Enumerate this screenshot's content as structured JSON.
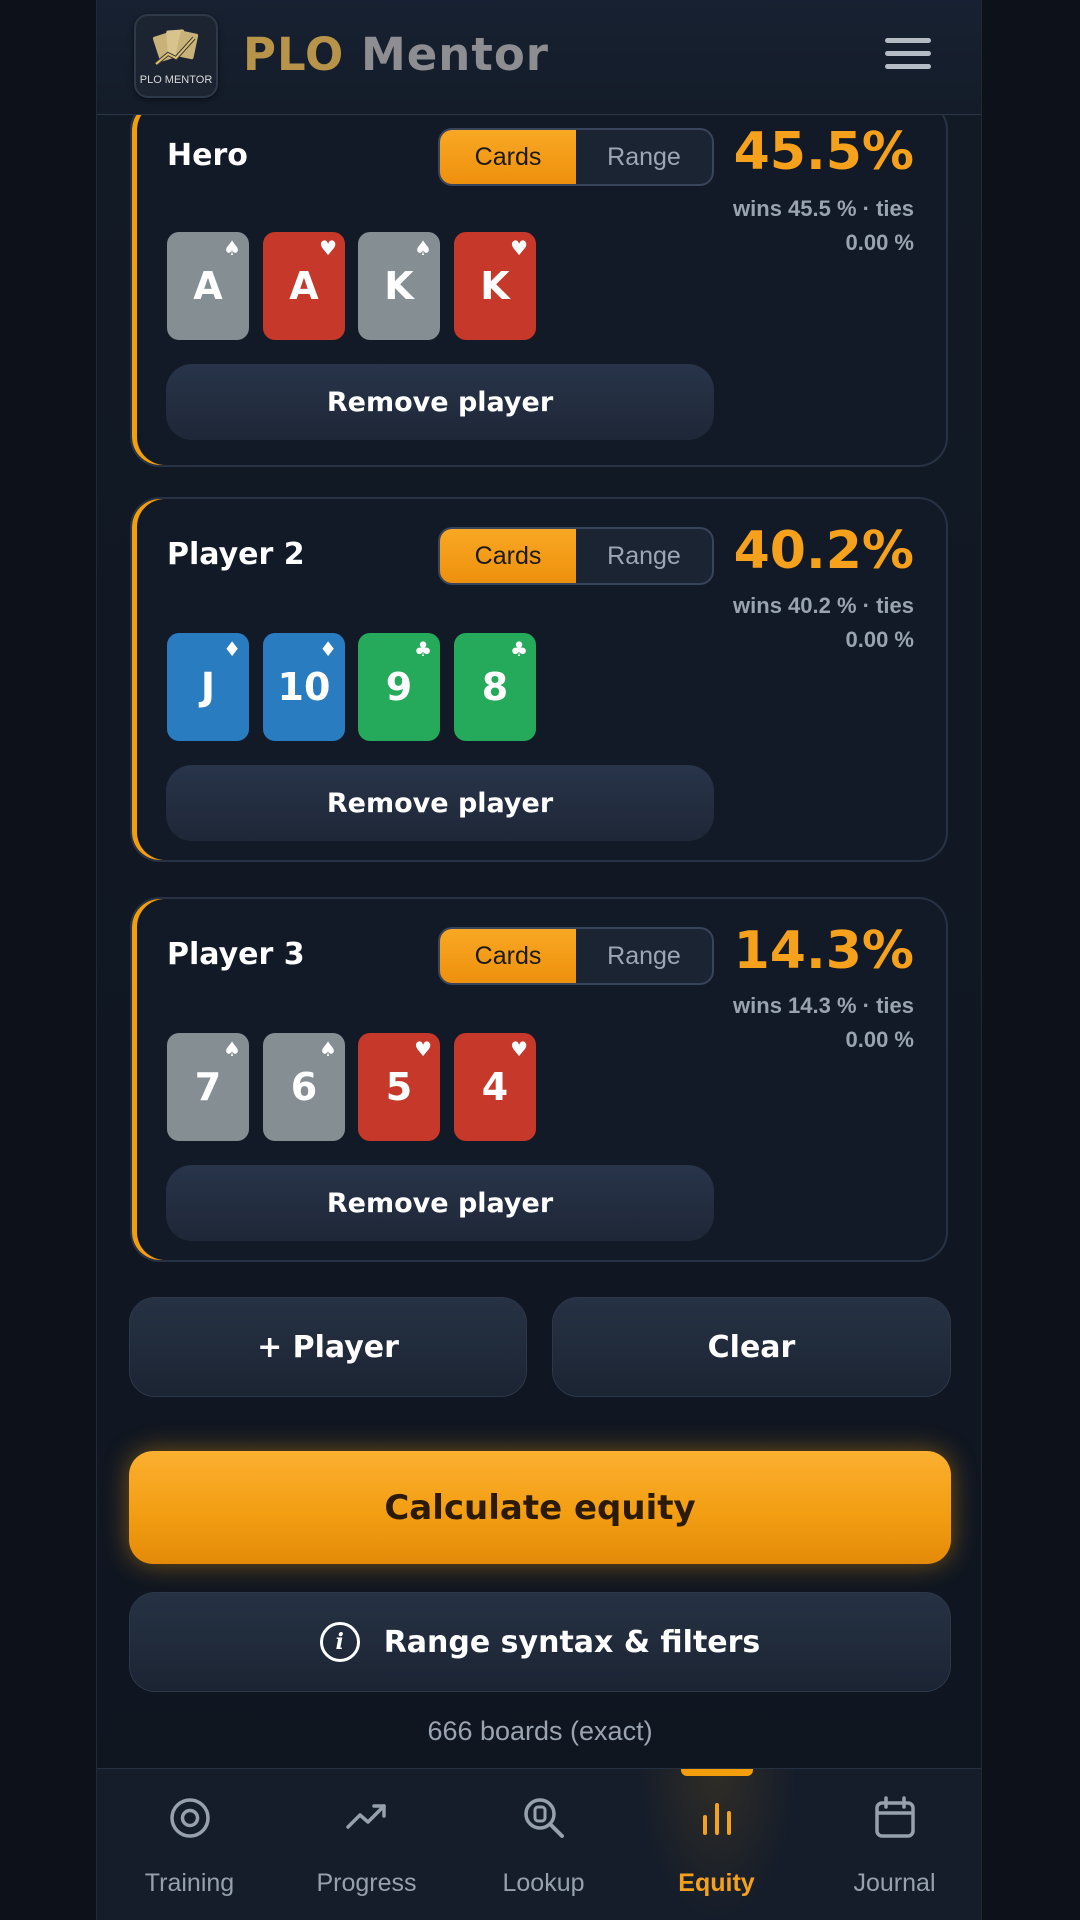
{
  "header": {
    "logo_caption": "PLO MENTOR",
    "brand_part1": "PLO",
    "brand_part2": "Mentor"
  },
  "toggle": {
    "cards_label": "Cards",
    "range_label": "Range"
  },
  "players": [
    {
      "name": "Hero",
      "equity": "45.5%",
      "wins_line": "wins 45.5 % · ties",
      "ties_value": "0.00 %",
      "cards": [
        {
          "rank": "A",
          "suit": "♠",
          "suit_name": "spade"
        },
        {
          "rank": "A",
          "suit": "♥",
          "suit_name": "heart"
        },
        {
          "rank": "K",
          "suit": "♠",
          "suit_name": "spade"
        },
        {
          "rank": "K",
          "suit": "♥",
          "suit_name": "heart"
        }
      ],
      "remove_label": "Remove player"
    },
    {
      "name": "Player 2",
      "equity": "40.2%",
      "wins_line": "wins 40.2 % · ties",
      "ties_value": "0.00 %",
      "cards": [
        {
          "rank": "J",
          "suit": "♦",
          "suit_name": "diamond"
        },
        {
          "rank": "10",
          "suit": "♦",
          "suit_name": "diamond"
        },
        {
          "rank": "9",
          "suit": "♣",
          "suit_name": "club"
        },
        {
          "rank": "8",
          "suit": "♣",
          "suit_name": "club"
        }
      ],
      "remove_label": "Remove player"
    },
    {
      "name": "Player 3",
      "equity": "14.3%",
      "wins_line": "wins 14.3 % · ties",
      "ties_value": "0.00 %",
      "cards": [
        {
          "rank": "7",
          "suit": "♠",
          "suit_name": "spade"
        },
        {
          "rank": "6",
          "suit": "♠",
          "suit_name": "spade"
        },
        {
          "rank": "5",
          "suit": "♥",
          "suit_name": "heart"
        },
        {
          "rank": "4",
          "suit": "♥",
          "suit_name": "heart"
        }
      ],
      "remove_label": "Remove player"
    }
  ],
  "actions": {
    "add_player_label": "+ Player",
    "clear_label": "Clear",
    "calculate_label": "Calculate equity",
    "syntax_label": "Range syntax & filters",
    "info_icon_glyph": "i"
  },
  "boards_note": "666 boards (exact)",
  "nav": {
    "items": [
      {
        "label": "Training",
        "icon": "target-icon"
      },
      {
        "label": "Progress",
        "icon": "trending-up-icon"
      },
      {
        "label": "Lookup",
        "icon": "search-icon"
      },
      {
        "label": "Equity",
        "icon": "bar-chart-icon"
      },
      {
        "label": "Journal",
        "icon": "calendar-icon"
      }
    ],
    "active": "Equity"
  },
  "colors": {
    "accent": "#f59e0b",
    "spade": "#858e92",
    "heart": "#c63829",
    "diamond": "#2a7cc0",
    "club": "#25a95a"
  }
}
